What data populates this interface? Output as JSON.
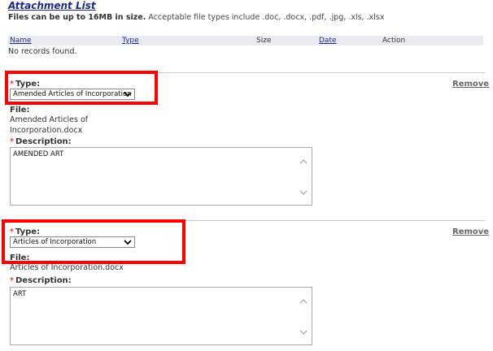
{
  "section": {
    "title": "Attachment List",
    "size_note_bold": "Files can be up to 16MB in size.",
    "size_note_rest": " Acceptable file types include .doc, .docx, .pdf, .jpg, .xls, .xlsx"
  },
  "table": {
    "columns": [
      "Name",
      "Type",
      "Size",
      "Date",
      "Action"
    ],
    "empty_text": "No records found."
  },
  "attachments": [
    {
      "type_label": "Type:",
      "type_value": "Amended Articles of Incorporation",
      "remove_label": "Remove",
      "file_label": "File:",
      "file_name_line1": "Amended Articles of",
      "file_name_line2": "Incorporation.docx",
      "desc_label": "Description:",
      "desc_value": "AMENDED ART"
    },
    {
      "type_label": "Type:",
      "type_value": "Articles of Incorporation",
      "remove_label": "Remove",
      "file_label": "File:",
      "file_name_line1": "Articles of Incorporation.docx",
      "desc_label": "Description:",
      "desc_value": "ART"
    }
  ],
  "colors": {
    "highlight": "#ff0000",
    "title": "#1a2a8c",
    "required": "#dd0000"
  }
}
